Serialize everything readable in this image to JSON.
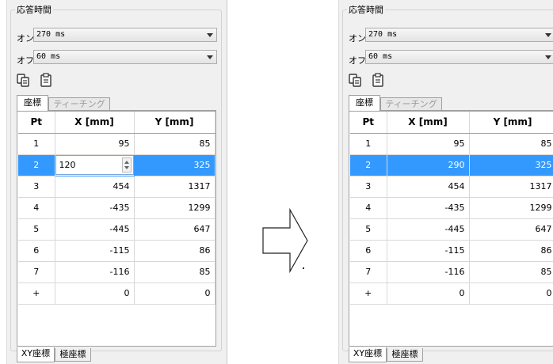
{
  "response_group_title": "応答時間",
  "on_label": "オン",
  "off_label": "オフ",
  "on_value": "270 ms",
  "off_value": "60 ms",
  "tabs": [
    "座標",
    "ティーチング"
  ],
  "bottom_tabs": [
    "XY座標",
    "極座標"
  ],
  "columns": [
    "Pt",
    "X [mm]",
    "Y [mm]"
  ],
  "selection_color": "#3399ff",
  "before": {
    "editing_value": "120",
    "rows": [
      [
        "1",
        "95",
        "85"
      ],
      [
        "2",
        "",
        "325"
      ],
      [
        "3",
        "454",
        "1317"
      ],
      [
        "4",
        "-435",
        "1299"
      ],
      [
        "5",
        "-445",
        "647"
      ],
      [
        "6",
        "-115",
        "86"
      ],
      [
        "7",
        "-116",
        "85"
      ],
      [
        "+",
        "0",
        "0"
      ]
    ]
  },
  "after": {
    "rows": [
      [
        "1",
        "95",
        "85"
      ],
      [
        "2",
        "290",
        "325"
      ],
      [
        "3",
        "454",
        "1317"
      ],
      [
        "4",
        "-435",
        "1299"
      ],
      [
        "5",
        "-445",
        "647"
      ],
      [
        "6",
        "-115",
        "86"
      ],
      [
        "7",
        "-116",
        "85"
      ],
      [
        "+",
        "0",
        "0"
      ]
    ]
  }
}
